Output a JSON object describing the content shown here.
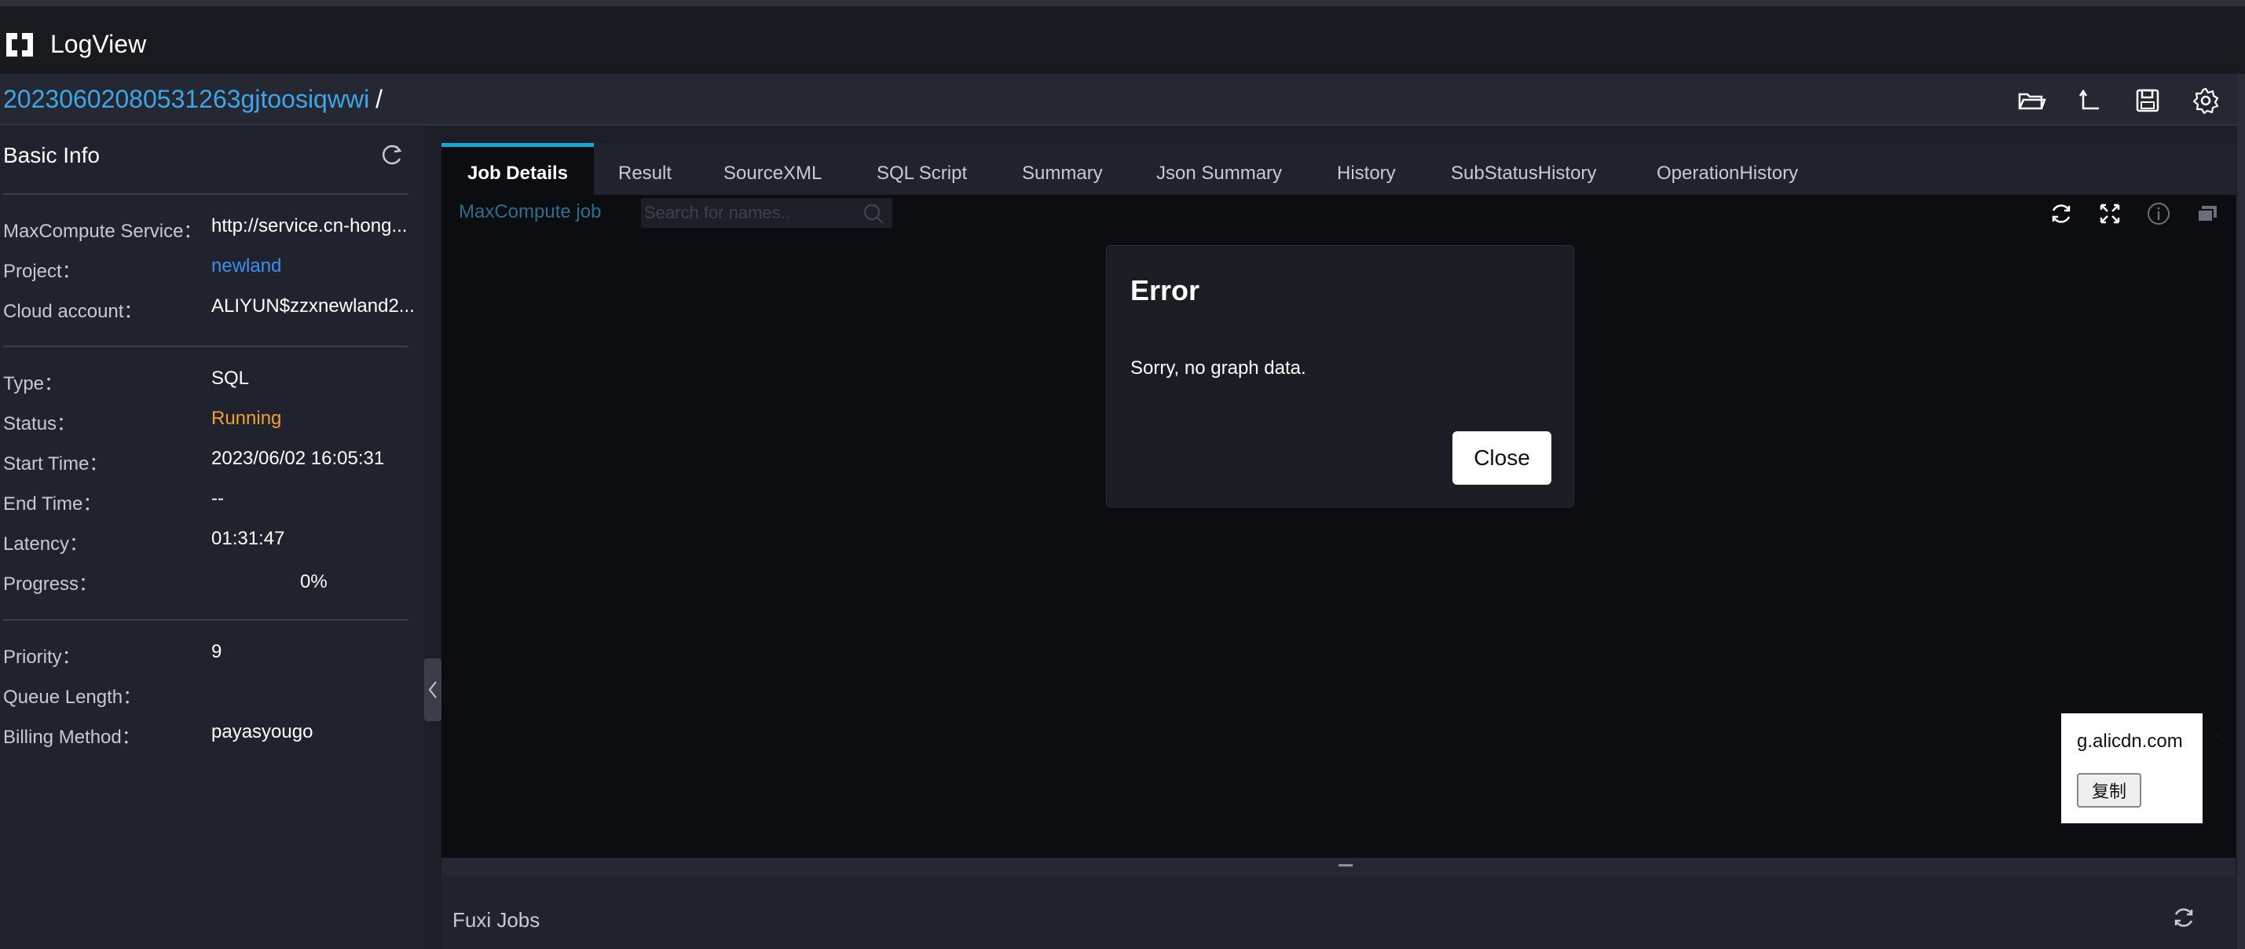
{
  "app": {
    "title": "LogView"
  },
  "job": {
    "id": "20230602080531263gjtoosiqwwi",
    "separator": "/"
  },
  "basic_info": {
    "title": "Basic Info",
    "group1": [
      {
        "key": "MaxCompute Service：",
        "value": "http://service.cn-hong..."
      },
      {
        "key": "Project：",
        "value": "newland"
      },
      {
        "key": "Cloud account：",
        "value": "ALIYUN$zzxnewland2..."
      }
    ],
    "group2": [
      {
        "key": "Type：",
        "value": "SQL"
      },
      {
        "key": "Status：",
        "value": "Running"
      },
      {
        "key": "Start Time：",
        "value": "2023/06/02 16:05:31"
      },
      {
        "key": "End Time：",
        "value": "--"
      },
      {
        "key": "Latency：",
        "value": "01:31:47"
      },
      {
        "key": "Progress：",
        "value": "0%"
      }
    ],
    "group3": [
      {
        "key": "Priority：",
        "value": "9"
      },
      {
        "key": "Queue Length：",
        "value": ""
      },
      {
        "key": "Billing Method：",
        "value": "payasyougo"
      }
    ]
  },
  "tabs": [
    {
      "label": "Job Details"
    },
    {
      "label": "Result"
    },
    {
      "label": "SourceXML"
    },
    {
      "label": "SQL Script"
    },
    {
      "label": "Summary"
    },
    {
      "label": "Json Summary"
    },
    {
      "label": "History"
    },
    {
      "label": "SubStatusHistory"
    },
    {
      "label": "OperationHistory"
    }
  ],
  "graph": {
    "label": "MaxCompute job",
    "search_placeholder": "Search for names.."
  },
  "dialog": {
    "title": "Error",
    "message": "Sorry, no graph data.",
    "close_label": "Close"
  },
  "bottom": {
    "title": "Fuxi Jobs"
  },
  "popup": {
    "host": "g.alicdn.com",
    "copy_label": "复制",
    "dismiss": "✕"
  },
  "colors": {
    "accent": "#1aa3d4",
    "link": "#3b8ff0",
    "running": "#f0a030"
  }
}
